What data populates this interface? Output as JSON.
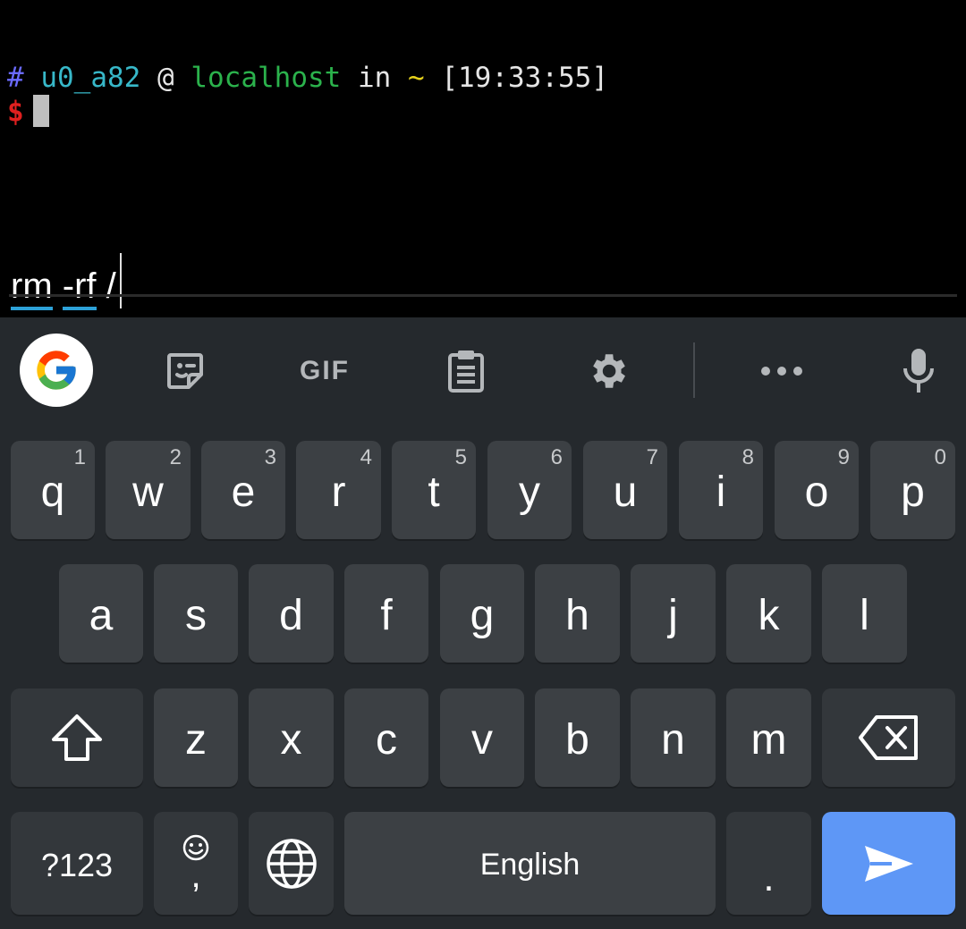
{
  "terminal": {
    "prompt": {
      "hash": "#",
      "user": "u0_a82",
      "at": "@",
      "host": "localhost",
      "in": "in",
      "dir": "~",
      "time": "[19:33:55]"
    },
    "shell_symbol": "$"
  },
  "input": {
    "words": [
      "rm",
      "-rf",
      "/"
    ]
  },
  "toolbar": {
    "gif_label": "GIF",
    "icons": [
      "google-icon",
      "sticker-icon",
      "gif-icon",
      "clipboard-icon",
      "settings-icon",
      "more-icon",
      "mic-icon"
    ]
  },
  "keyboard": {
    "row1": [
      {
        "key": "q",
        "hint": "1"
      },
      {
        "key": "w",
        "hint": "2"
      },
      {
        "key": "e",
        "hint": "3"
      },
      {
        "key": "r",
        "hint": "4"
      },
      {
        "key": "t",
        "hint": "5"
      },
      {
        "key": "y",
        "hint": "6"
      },
      {
        "key": "u",
        "hint": "7"
      },
      {
        "key": "i",
        "hint": "8"
      },
      {
        "key": "o",
        "hint": "9"
      },
      {
        "key": "p",
        "hint": "0"
      }
    ],
    "row2": [
      "a",
      "s",
      "d",
      "f",
      "g",
      "h",
      "j",
      "k",
      "l"
    ],
    "row3": [
      "z",
      "x",
      "c",
      "v",
      "b",
      "n",
      "m"
    ],
    "symbols_label": "?123",
    "comma": ",",
    "space_label": "English",
    "period": "."
  },
  "colors": {
    "keyboard_bg": "#25292d",
    "key_bg": "#3c4044",
    "enter_key": "#5e97f6",
    "underline_accent": "#2da2d8"
  }
}
